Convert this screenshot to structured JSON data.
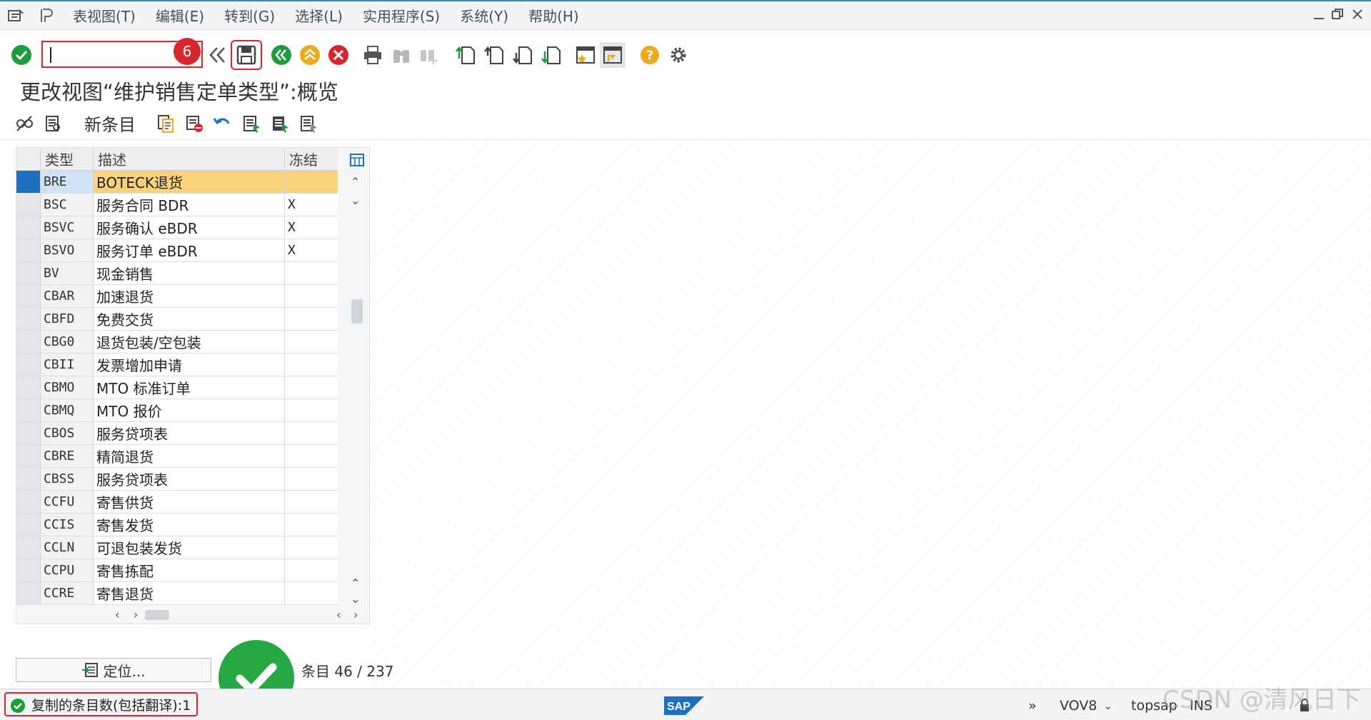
{
  "menubar": {
    "items": [
      "表视图(T)",
      "编辑(E)",
      "转到(G)",
      "选择(L)",
      "实用程序(S)",
      "系统(Y)",
      "帮助(H)"
    ]
  },
  "toolbar": {
    "command_value": "",
    "badge": "6"
  },
  "title": "更改视图“维护销售定单类型”:概览",
  "app_toolbar": {
    "new_entries": "新条目"
  },
  "table": {
    "headers": [
      "类型",
      "描述",
      "冻结"
    ],
    "rows": [
      {
        "type": "BRE",
        "desc": "BOTECK退货",
        "frozen": ""
      },
      {
        "type": "BSC",
        "desc": "服务合同 BDR",
        "frozen": "X"
      },
      {
        "type": "BSVC",
        "desc": "服务确认 eBDR",
        "frozen": "X"
      },
      {
        "type": "BSVO",
        "desc": "服务订单 eBDR",
        "frozen": "X"
      },
      {
        "type": "BV",
        "desc": "现金销售",
        "frozen": ""
      },
      {
        "type": "CBAR",
        "desc": "加速退货",
        "frozen": ""
      },
      {
        "type": "CBFD",
        "desc": "免费交货",
        "frozen": ""
      },
      {
        "type": "CBG0",
        "desc": "退货包装/空包装",
        "frozen": ""
      },
      {
        "type": "CBII",
        "desc": "发票增加申请",
        "frozen": ""
      },
      {
        "type": "CBMO",
        "desc": "MTO 标准订单",
        "frozen": ""
      },
      {
        "type": "CBMQ",
        "desc": "MTO 报价",
        "frozen": ""
      },
      {
        "type": "CBOS",
        "desc": "服务贷项表",
        "frozen": ""
      },
      {
        "type": "CBRE",
        "desc": "精简退货",
        "frozen": ""
      },
      {
        "type": "CBSS",
        "desc": "服务贷项表",
        "frozen": ""
      },
      {
        "type": "CCFU",
        "desc": "寄售供货",
        "frozen": ""
      },
      {
        "type": "CCIS",
        "desc": "寄售发货",
        "frozen": ""
      },
      {
        "type": "CCLN",
        "desc": "可退包装发货",
        "frozen": ""
      },
      {
        "type": "CCPU",
        "desc": "寄售拣配",
        "frozen": ""
      },
      {
        "type": "CCRE",
        "desc": "寄售退货",
        "frozen": ""
      }
    ]
  },
  "bottom": {
    "position_label": "定位...",
    "entry_label": "条目 46 / 237"
  },
  "statusbar": {
    "message": "复制的条目数(包括翻译):1",
    "tcode": "VOV8",
    "server": "topsap",
    "mode": "INS",
    "watermark": "CSDN @清风日下"
  },
  "colors": {
    "accent": "#2e8bd8",
    "highlight_red": "#d7262e",
    "success_green": "#28a745",
    "selected_row": "#f8d37c"
  }
}
